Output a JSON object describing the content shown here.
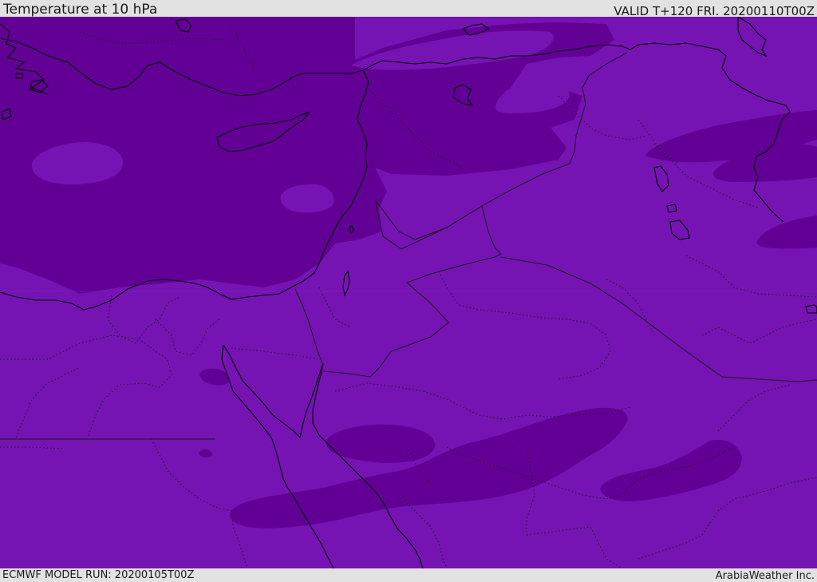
{
  "header": {
    "title": "Temperature at 10 hPa",
    "valid": "VALID T+120 FRI. 20200110T00Z"
  },
  "footer": {
    "model_run": "ECMWF MODEL RUN: 20200105T00Z",
    "credit": "ArabiaWeather Inc."
  },
  "map": {
    "colors": {
      "band_dark": "#620095",
      "band_light": "#7513b3",
      "band_pale": "#8321c1",
      "coastline": "#000000",
      "border": "#1a1a1a"
    }
  }
}
